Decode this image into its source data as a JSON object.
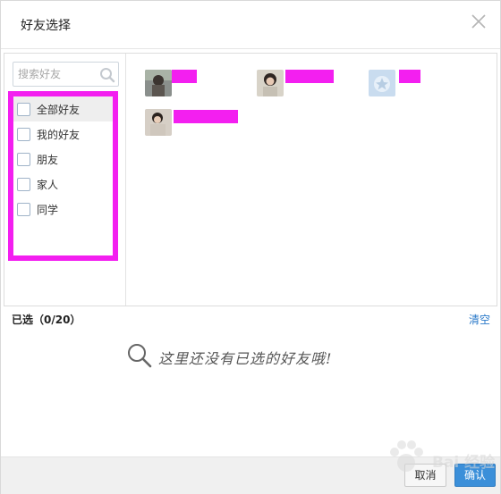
{
  "dialog": {
    "title": "好友选择",
    "close_icon": "close-icon"
  },
  "search": {
    "placeholder": "搜索好友",
    "icon": "search-icon"
  },
  "groups": [
    {
      "label": "全部好友",
      "checked": false,
      "active": true
    },
    {
      "label": "我的好友",
      "checked": false,
      "active": false
    },
    {
      "label": "朋友",
      "checked": false,
      "active": false
    },
    {
      "label": "家人",
      "checked": false,
      "active": false
    },
    {
      "label": "同学",
      "checked": false,
      "active": false
    }
  ],
  "friends": [
    {
      "avatar_icon": "avatar-photo-1",
      "name_redacted": true
    },
    {
      "avatar_icon": "avatar-photo-2",
      "name_redacted": true
    },
    {
      "avatar_icon": "avatar-default-star",
      "name_redacted": true
    },
    {
      "avatar_icon": "avatar-photo-3",
      "name_redacted": true
    }
  ],
  "selection": {
    "label": "已选（0/20）",
    "clear_label": "清空",
    "empty_message": "这里还没有已选的好友哦!",
    "empty_icon": "magnifier-icon"
  },
  "footer": {
    "cancel_label": "取消",
    "ok_label": "确认"
  },
  "watermark": {
    "text": "Bai 经验",
    "icon": "paw-icon"
  },
  "colors": {
    "highlight_box": "#f31ff0",
    "link": "#2a79c9",
    "primary_button": "#3b8fd9"
  }
}
